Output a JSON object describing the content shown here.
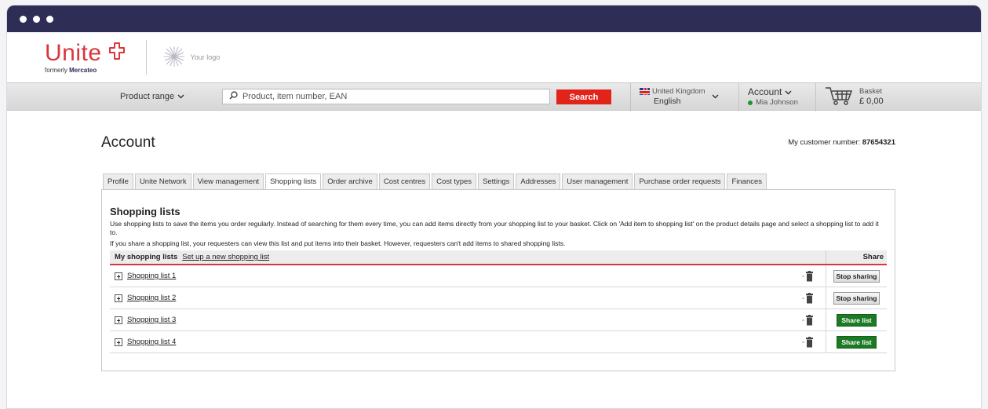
{
  "brand": {
    "name": "Unite",
    "formerly_prefix": "formerly",
    "formerly_name": "Mercateo",
    "your_logo": "Your logo",
    "accent": "#d9363e"
  },
  "nav": {
    "product_range": "Product range",
    "search_placeholder": "Product, item number, EAN",
    "search_button": "Search",
    "country": "United Kingdom",
    "language": "English",
    "account_label": "Account",
    "user_name": "Mia Johnson",
    "basket_label": "Basket",
    "basket_amount": "£ 0,00"
  },
  "page": {
    "title": "Account",
    "customer_number_label": "My customer number:",
    "customer_number": "87654321"
  },
  "tabs": [
    {
      "label": "Profile",
      "active": false
    },
    {
      "label": "Unite Network",
      "active": false
    },
    {
      "label": "View management",
      "active": false
    },
    {
      "label": "Shopping lists",
      "active": true
    },
    {
      "label": "Order archive",
      "active": false
    },
    {
      "label": "Cost centres",
      "active": false
    },
    {
      "label": "Cost types",
      "active": false
    },
    {
      "label": "Settings",
      "active": false
    },
    {
      "label": "Addresses",
      "active": false
    },
    {
      "label": "User management",
      "active": false
    },
    {
      "label": "Purchase order requests",
      "active": false
    },
    {
      "label": "Finances",
      "active": false
    }
  ],
  "shopping": {
    "title": "Shopping lists",
    "desc1": "Use shopping lists to save the items you order regularly. Instead of searching for them every time, you can add items directly from your shopping list to your basket. Click on 'Add item to shopping list' on the product details page and select a shopping list to add it to.",
    "desc2": "If you share a shopping list, your requesters can view this list and put items into their basket. However, requesters can't add items to shared shopping lists.",
    "col_mine": "My shopping lists",
    "col_setup": "Set up a new shopping list",
    "col_share": "Share",
    "lists": [
      {
        "name": "Shopping list 1",
        "action": "Stop sharing",
        "shared": true
      },
      {
        "name": "Shopping list 2",
        "action": "Stop sharing",
        "shared": true
      },
      {
        "name": "Shopping list 3",
        "action": "Share list",
        "shared": false
      },
      {
        "name": "Shopping list 4",
        "action": "Share list",
        "shared": false
      }
    ]
  }
}
